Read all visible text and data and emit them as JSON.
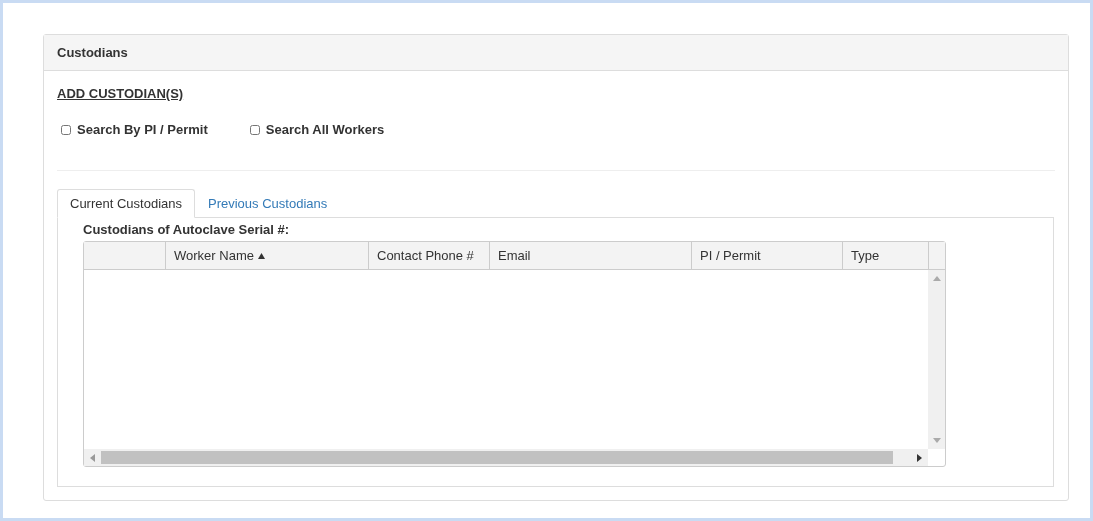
{
  "panel": {
    "title": "Custodians"
  },
  "add_link": "ADD CUSTODIAN(S)",
  "options": [
    {
      "label": "Search By PI / Permit",
      "checked": false
    },
    {
      "label": "Search All Workers",
      "checked": false
    }
  ],
  "tabs": [
    {
      "label": "Current Custodians",
      "selected": true
    },
    {
      "label": "Previous Custodians",
      "selected": false
    }
  ],
  "grid": {
    "caption": "Custodians of Autoclave Serial #:",
    "columns": [
      {
        "sorted": false
      },
      {
        "label": "Worker Name",
        "sorted": true
      },
      {
        "label": "Contact Phone #",
        "sorted": false
      },
      {
        "label": "Email",
        "sorted": false
      },
      {
        "label": "PI / Permit",
        "sorted": false
      },
      {
        "label": "Type",
        "sorted": false
      }
    ]
  }
}
